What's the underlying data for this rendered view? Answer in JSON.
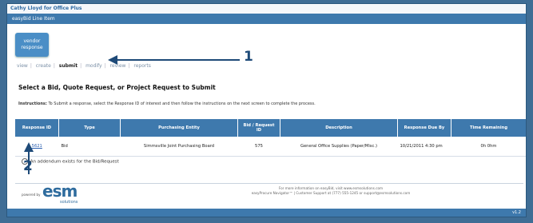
{
  "window": {
    "title": "Cathy Lloyd for Office Plus"
  },
  "app": {
    "bar_title": "easyBid Line Item"
  },
  "tile": {
    "line1": "vendor",
    "line2": "response"
  },
  "steps": [
    "view",
    "create",
    "submit",
    "modify",
    "review",
    "reports"
  ],
  "page": {
    "heading": "Select a Bid, Quote Request, or Project Request to Submit",
    "instructions_label": "Instructions:",
    "instructions_text": "To Submit a response, select the Response ID of interest and then follow the instructions on the next screen to complete the process."
  },
  "table": {
    "headers": [
      "Response ID",
      "Type",
      "Purchasing Entity",
      "Bid / Request ID",
      "Description",
      "Response Due By",
      "Time Remaining"
    ],
    "rows": [
      {
        "response_id": "5621",
        "type": "Bid",
        "entity": "Simmsville Joint Purchasing Board",
        "request_id": "575",
        "description": "General Office Supplies (Paper/Misc.)",
        "due": "10/21/2011 4:30 pm",
        "remaining": "0h 0hm"
      }
    ]
  },
  "addendum": "An addendum exists for the Bid/Request",
  "footer": {
    "line1": "For more information on easyBid, visit www.esmsolutions.com",
    "line2": "easyProcure Navigator™ | Customer Support at (777) 555-1245 or support@esmsolutions.com",
    "powered_by": "powered by",
    "logo": "esm",
    "logo_sub": "solutions"
  },
  "bottombar": {
    "text": "v1.2"
  },
  "annotations": {
    "label1": "1",
    "label2": "2",
    "color": "#1e4a78"
  },
  "colors": {
    "accent": "#3e79ad",
    "link": "#2a5fb0",
    "alert": "#d24a2e",
    "background": "#3f6d95"
  }
}
